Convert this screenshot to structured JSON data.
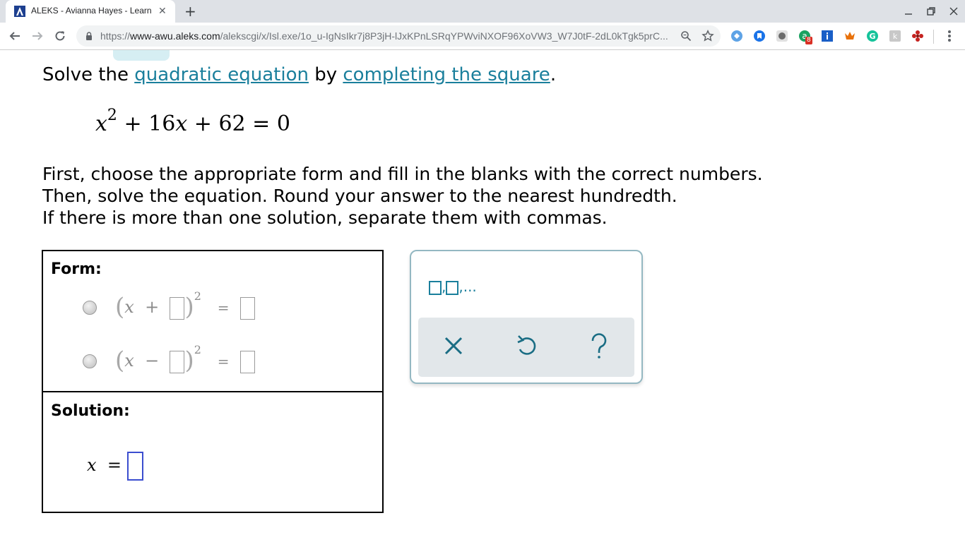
{
  "browser": {
    "tab_title": "ALEKS - Avianna Hayes - Learn",
    "url_prefix": "https://",
    "url_host": "www-awu.aleks.com",
    "url_path": "/alekscgi/x/Isl.exe/1o_u-IgNsIkr7j8P3jH-lJxKPnLSRqYPWviNXOF96XoVW3_W7J0tF-2dL0kTgk5prC...",
    "extension_badge": "8"
  },
  "question": {
    "prompt_prefix": "Solve the ",
    "link_quadratic": "quadratic equation",
    "prompt_middle": " by ",
    "link_completing": "completing the square",
    "prompt_suffix": ".",
    "equation": {
      "var": "x",
      "exponent": "2",
      "rest": " + 16",
      "var2": "x",
      "rest2": " + 62 = 0"
    },
    "instructions": [
      "First, choose the appropriate form and fill in the blanks with the correct numbers.",
      "Then, solve the equation. Round your answer to the nearest hundredth.",
      "If there is more than one solution, separate them with commas."
    ]
  },
  "answer": {
    "form_label": "Form:",
    "option_plus": {
      "var": "x",
      "op": "+",
      "exp": "2",
      "eq": "="
    },
    "option_minus": {
      "var": "x",
      "op": "−",
      "exp": "2",
      "eq": "="
    },
    "solution_label": "Solution:",
    "solution_var": "x",
    "solution_eq": "="
  },
  "keypad": {
    "list_sep": ",",
    "list_sep2": ",...",
    "clear_label": "×",
    "undo_label": "↺",
    "help_label": "?"
  }
}
